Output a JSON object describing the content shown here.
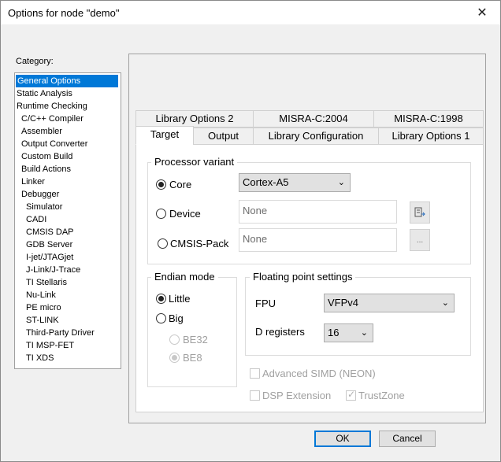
{
  "window": {
    "title": "Options for node \"demo\"",
    "close_glyph": "✕"
  },
  "category": {
    "label": "Category:",
    "items": [
      {
        "label": "General Options",
        "level": 0,
        "selected": true
      },
      {
        "label": "Static Analysis",
        "level": 0
      },
      {
        "label": "Runtime Checking",
        "level": 0
      },
      {
        "label": "C/C++ Compiler",
        "level": 1
      },
      {
        "label": "Assembler",
        "level": 1
      },
      {
        "label": "Output Converter",
        "level": 1
      },
      {
        "label": "Custom Build",
        "level": 1
      },
      {
        "label": "Build Actions",
        "level": 1
      },
      {
        "label": "Linker",
        "level": 1
      },
      {
        "label": "Debugger",
        "level": 1
      },
      {
        "label": "Simulator",
        "level": 2
      },
      {
        "label": "CADI",
        "level": 2
      },
      {
        "label": "CMSIS DAP",
        "level": 2
      },
      {
        "label": "GDB Server",
        "level": 2
      },
      {
        "label": "I-jet/JTAGjet",
        "level": 2
      },
      {
        "label": "J-Link/J-Trace",
        "level": 2
      },
      {
        "label": "TI Stellaris",
        "level": 2
      },
      {
        "label": "Nu-Link",
        "level": 2
      },
      {
        "label": "PE micro",
        "level": 2
      },
      {
        "label": "ST-LINK",
        "level": 2
      },
      {
        "label": "Third-Party Driver",
        "level": 2
      },
      {
        "label": "TI MSP-FET",
        "level": 2
      },
      {
        "label": "TI XDS",
        "level": 2
      }
    ]
  },
  "tabs": {
    "row1": [
      "Library Options 2",
      "MISRA-C:2004",
      "MISRA-C:1998"
    ],
    "row2": [
      "Target",
      "Output",
      "Library Configuration",
      "Library Options 1"
    ],
    "active": "Target"
  },
  "processor": {
    "title": "Processor variant",
    "core_label": "Core",
    "core_value": "Cortex-A5",
    "device_label": "Device",
    "device_value": "None",
    "cmsis_label": "CMSIS-Pack",
    "cmsis_value": "None",
    "cmsis_browse": "...",
    "selected": "Core"
  },
  "endian": {
    "title": "Endian mode",
    "little": "Little",
    "big": "Big",
    "be32": "BE32",
    "be8": "BE8",
    "selected": "Little"
  },
  "fpu": {
    "title": "Floating point settings",
    "fpu_label": "FPU",
    "fpu_value": "VFPv4",
    "dreg_label": "D registers",
    "dreg_value": "16"
  },
  "options": {
    "simd": "Advanced SIMD (NEON)",
    "dsp": "DSP Extension",
    "trustzone": "TrustZone"
  },
  "buttons": {
    "ok": "OK",
    "cancel": "Cancel"
  }
}
